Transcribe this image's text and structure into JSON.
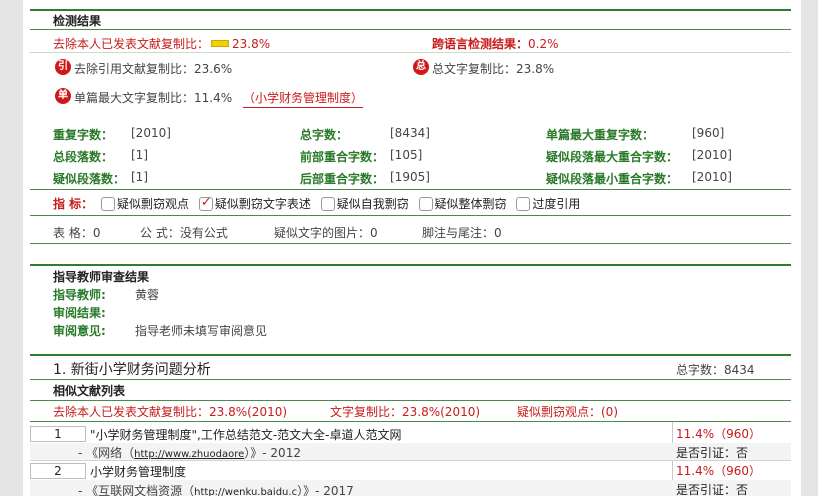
{
  "detection": {
    "section_title": "检测结果",
    "excl_self_label": "去除本人已发表文献复制比：",
    "excl_self_value": "23.8%",
    "cross_lang_label": "跨语言检测结果：",
    "cross_lang_value": "0.2%",
    "badge_cite": "引",
    "excl_cite_label": "去除引用文献复制比：",
    "excl_cite_value": "23.6%",
    "badge_total": "总",
    "total_copy_label": "总文字复制比：",
    "total_copy_value": "23.8%",
    "badge_single": "单",
    "single_max_label": "单篇最大文字复制比：",
    "single_max_value": "11.4%",
    "single_max_title": "（小学财务管理制度）"
  },
  "stats": {
    "dup_chars_label": "重复字数：",
    "dup_chars_value": "[2010]",
    "total_chars_label": "总字数：",
    "total_chars_value": "[8434]",
    "single_max_dup_label": "单篇最大重复字数：",
    "single_max_dup_value": "[960]",
    "total_paras_label": "总段落数：",
    "total_paras_value": "[1]",
    "front_overlap_label": "前部重合字数：",
    "front_overlap_value": "[105]",
    "susp_para_max_label": "疑似段落最大重合字数：",
    "susp_para_max_value": "[2010]",
    "susp_paras_label": "疑似段落数：",
    "susp_paras_value": "[1]",
    "back_overlap_label": "后部重合字数：",
    "back_overlap_value": "[1905]",
    "susp_para_min_label": "疑似段落最小重合字数：",
    "susp_para_min_value": "[2010]"
  },
  "indicators": {
    "label": "指 标：",
    "items": [
      {
        "label": "疑似剽窃观点",
        "checked": false
      },
      {
        "label": "疑似剽窃文字表述",
        "checked": true
      },
      {
        "label": "疑似自我剽窃",
        "checked": false
      },
      {
        "label": "疑似整体剽窃",
        "checked": false
      },
      {
        "label": "过度引用",
        "checked": false
      }
    ]
  },
  "counts": {
    "tables": "表 格：0",
    "formulas": "公 式：没有公式",
    "images": "疑似文字的图片：0",
    "footnotes": "脚注与尾注：0"
  },
  "review": {
    "title": "指导教师审查结果",
    "teacher_label": "指导教师:",
    "teacher_value": "黄蓉",
    "result_label": "审阅结果:",
    "opinion_label": "审阅意见:",
    "opinion_value": "指导老师未填写审阅意见"
  },
  "section1": {
    "title": "1. 新街小学财务问题分析",
    "total_chars": "总字数：8434",
    "similar_list_title": "相似文献列表",
    "excl_self": "去除本人已发表文献复制比：23.8%(2010)",
    "copy_ratio": "文字复制比：23.8%(2010)",
    "susp_view": "疑似剽窃观点：(0)"
  },
  "documents": [
    {
      "num": "1",
      "title": "\"小学财务管理制度\",工作总结范文-范文大全-卓道人范文网",
      "source_prefix": "- 《网络（",
      "source_url": "http://www.zhuodaore",
      "source_suffix": "）》- 2012",
      "ratio": "11.4%（960）",
      "cited": "是否引证：否"
    },
    {
      "num": "2",
      "title": "小学财务管理制度",
      "source_prefix": "- 《互联网文档资源（",
      "source_url": "http://wenku.baidu.c",
      "source_suffix": "）》- 2017",
      "ratio": "11.4%（960）",
      "cited": "是否引证：否"
    }
  ],
  "colors": {
    "accent_green": "#2e7d32",
    "alert_red": "#c81b1b"
  }
}
